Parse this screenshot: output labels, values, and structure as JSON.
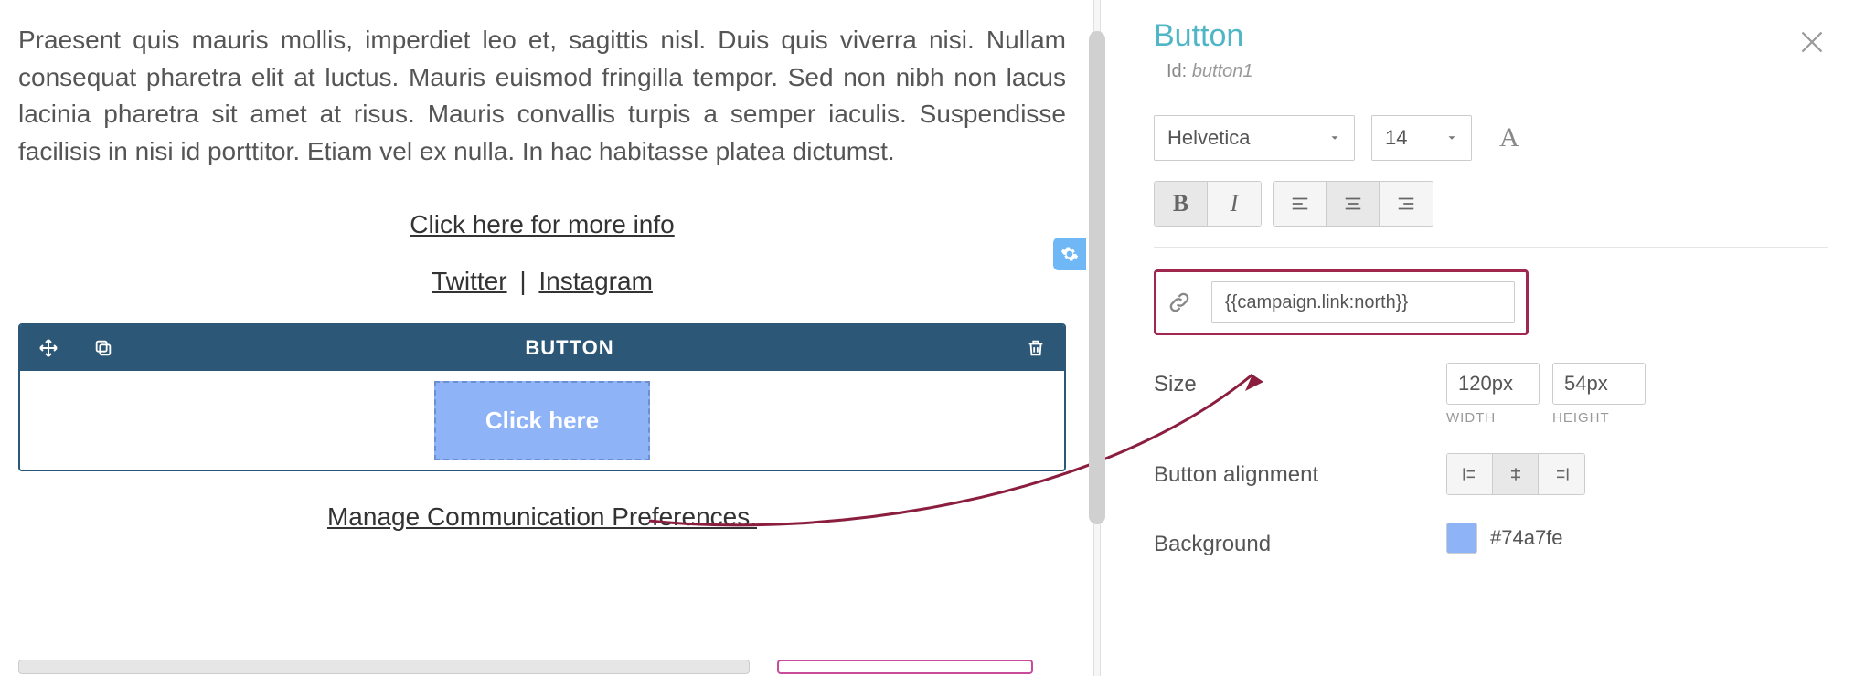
{
  "canvas": {
    "body_text": "Praesent quis mauris mollis, imperdiet leo et, sagittis nisl. Duis quis viverra nisi. Nullam consequat pharetra elit at luctus. Mauris euismod fringilla tempor. Sed non nibh non lacus lacinia pharetra sit amet at risus. Mauris convallis turpis a semper iaculis. Suspendisse facilisis in nisi id porttitor. Etiam vel ex nulla. In hac habitasse platea dictumst.",
    "more_info_link": "Click here for more info",
    "twitter": "Twitter",
    "instagram": "Instagram",
    "block_title": "BUTTON",
    "button_label": "Click here",
    "manage_prefs": "Manage Communication Preferences."
  },
  "panel": {
    "title": "Button",
    "id_label": "Id:",
    "id_value": "button1",
    "font": "Helvetica",
    "font_size": "14",
    "bold_glyph": "B",
    "italic_glyph": "I",
    "a_glyph": "A",
    "link_value": "{{campaign.link:north}}",
    "size_label": "Size",
    "width_value": "120px",
    "width_caption": "WIDTH",
    "height_value": "54px",
    "height_caption": "HEIGHT",
    "alignment_label": "Button alignment",
    "background_label": "Background",
    "background_value": "#74a7fe"
  }
}
